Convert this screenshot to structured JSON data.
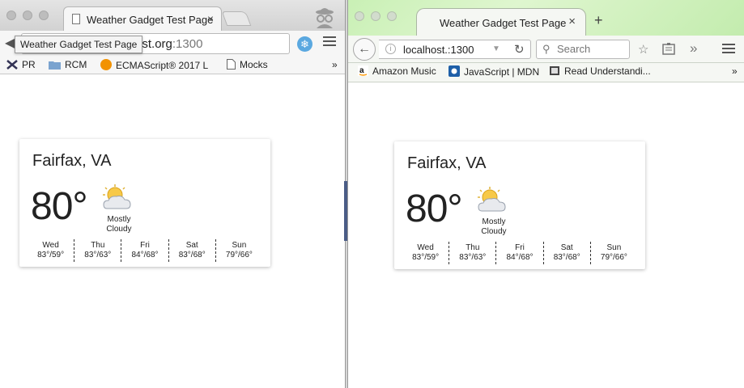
{
  "chrome": {
    "tab_title": "Weather Gadget Test Page",
    "tab_close": "×",
    "tooltip": "Weather Gadget Test Page",
    "address_host": "alhost.org",
    "address_port": ":1300",
    "ext_icon": "❄",
    "bookmarks": [
      {
        "label": "PR",
        "icon": "tools-icon"
      },
      {
        "label": "RCM",
        "icon": "folder-icon"
      },
      {
        "label": "ECMAScript® 2017 L",
        "icon": "ecma-icon"
      },
      {
        "label": "Mocks",
        "icon": "page-icon"
      }
    ],
    "overflow": "»"
  },
  "firefox": {
    "tab_title": "Weather Gadget Test Page",
    "tab_close": "×",
    "new_tab": "+",
    "url": "localhost.:1300",
    "search_placeholder": "Search",
    "overflow": "»",
    "bookmarks": [
      {
        "label": "Amazon Music",
        "icon": "amazon-icon"
      },
      {
        "label": "JavaScript | MDN",
        "icon": "mdn-icon"
      },
      {
        "label": "Read Understandi...",
        "icon": "book-icon"
      }
    ]
  },
  "weather": {
    "city": "Fairfax, VA",
    "temp": "80°",
    "condition_line1": "Mostly",
    "condition_line2": "Cloudy",
    "forecast": [
      {
        "day": "Wed",
        "range": "83°/59°"
      },
      {
        "day": "Thu",
        "range": "83°/63°"
      },
      {
        "day": "Fri",
        "range": "84°/68°"
      },
      {
        "day": "Sat",
        "range": "83°/68°"
      },
      {
        "day": "Sun",
        "range": "79°/66°"
      }
    ]
  }
}
